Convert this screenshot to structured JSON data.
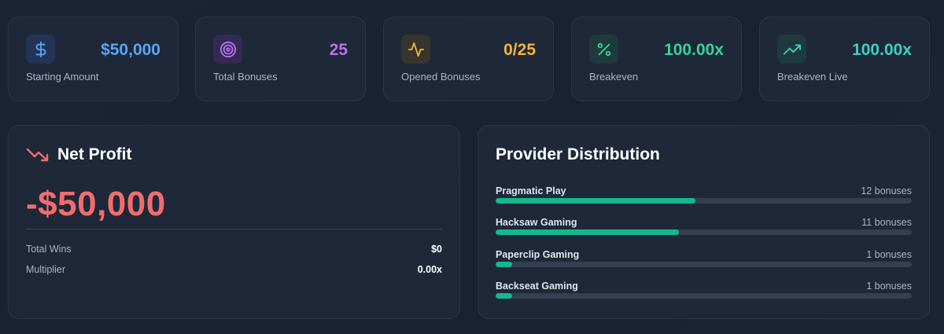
{
  "stats": [
    {
      "label": "Starting Amount",
      "value": "$50,000",
      "icon": "dollar-icon",
      "color": "#5aa5f5",
      "icon_bg": "#233456"
    },
    {
      "label": "Total Bonuses",
      "value": "25",
      "icon": "target-icon",
      "color": "#b872f2",
      "icon_bg": "#342a55"
    },
    {
      "label": "Opened Bonuses",
      "value": "0/25",
      "icon": "activity-icon",
      "color": "#f2b43a",
      "icon_bg": "#37352e"
    },
    {
      "label": "Breakeven",
      "value": "100.00x",
      "icon": "percent-icon",
      "color": "#37d39a",
      "icon_bg": "#1e3a3d"
    },
    {
      "label": "Breakeven Live",
      "value": "100.00x",
      "icon": "trending-up-icon",
      "color": "#3dd1c2",
      "icon_bg": "#1e3a3f"
    }
  ],
  "net_profit": {
    "title": "Net Profit",
    "value": "-$50,000",
    "icon": "trending-down-icon",
    "color": "#f26d6d",
    "rows": [
      {
        "label": "Total Wins",
        "value": "$0"
      },
      {
        "label": "Multiplier",
        "value": "0.00x"
      }
    ]
  },
  "provider_distribution": {
    "title": "Provider Distribution",
    "bar_color": "#14b88e",
    "providers": [
      {
        "name": "Pragmatic Play",
        "count_label": "12 bonuses",
        "share": 0.48
      },
      {
        "name": "Hacksaw Gaming",
        "count_label": "11 bonuses",
        "share": 0.44
      },
      {
        "name": "Paperclip Gaming",
        "count_label": "1 bonuses",
        "share": 0.04
      },
      {
        "name": "Backseat Gaming",
        "count_label": "1 bonuses",
        "share": 0.04
      }
    ]
  }
}
